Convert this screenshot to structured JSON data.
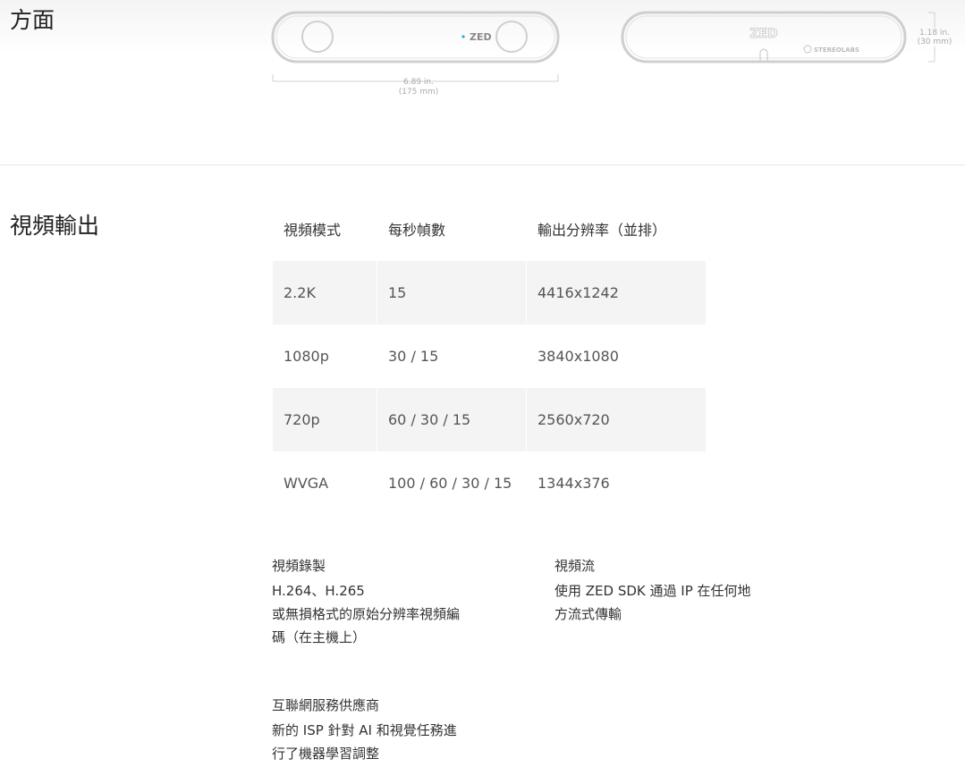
{
  "dimensions": {
    "title": "方面",
    "width_label_in": "6.89 in.",
    "width_label_mm": "(175 mm)",
    "height_label_in": "1.18 in.",
    "height_label_mm": "(30 mm)",
    "front_logo": "ZED",
    "top_logo": "ZED",
    "brand": "STEREOLABS"
  },
  "video_output": {
    "title": "視頻輸出",
    "table": {
      "headers": [
        "視頻模式",
        "每秒幀數",
        "輸出分辨率（並排）"
      ],
      "rows": [
        [
          "2.2K",
          "15",
          "4416x1242"
        ],
        [
          "1080p",
          "30 / 15",
          "3840x1080"
        ],
        [
          "720p",
          "60 / 30 / 15",
          "2560x720"
        ],
        [
          "WVGA",
          "100 / 60 / 30 / 15",
          "1344x376"
        ]
      ]
    },
    "features": {
      "recording": {
        "title": "視頻錄製",
        "lines": [
          "H.264、H.265",
          "或無損格式的原始分辨率視頻編",
          "碼（在主機上）"
        ]
      },
      "streaming": {
        "title": "視頻流",
        "lines": [
          "使用 ZED SDK 通過 IP 在任何地",
          "方流式傳輸"
        ]
      },
      "isp": {
        "title": "互聯網服務供應商",
        "lines": [
          "新的 ISP 針對 AI 和視覺任務進",
          "行了機器學習調整"
        ]
      }
    }
  },
  "colors": {
    "accent_dot": "#29abe2",
    "line": "#d0d0d0",
    "shade": "#f4f4f4"
  }
}
